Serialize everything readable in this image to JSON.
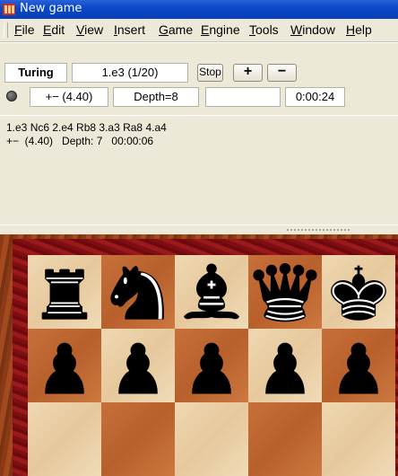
{
  "window": {
    "title": "New game"
  },
  "menu": [
    {
      "label": "File",
      "underline": "F",
      "rest": "ile"
    },
    {
      "label": "Edit",
      "underline": "E",
      "rest": "dit"
    },
    {
      "label": "View",
      "underline": "V",
      "rest": "iew"
    },
    {
      "label": "Insert",
      "underline": "I",
      "rest": "nsert"
    },
    {
      "label": "Game",
      "underline": "G",
      "rest": "ame"
    },
    {
      "label": "Engine",
      "underline": "E",
      "rest": "ngine"
    },
    {
      "label": "Tools",
      "underline": "T",
      "rest": "ools"
    },
    {
      "label": "Window",
      "underline": "W",
      "rest": "indow"
    },
    {
      "label": "Help",
      "underline": "H",
      "rest": "elp"
    }
  ],
  "engine": {
    "name": "Turing",
    "current_move": "1.e3 (1/20)",
    "stop_label": "Stop",
    "plus_label": "+",
    "minus_label": "−",
    "eval": "+−  (4.40)",
    "depth": "Depth=8",
    "extra": "",
    "time": "0:00:24",
    "analysis_line1": "1.e3 Nc6 2.e4 Rb8 3.a3 Ra8 4.a4",
    "analysis_line2": "+−  (4.40)   Depth: 7   00:00:06"
  },
  "board": {
    "rank8": [
      "rook",
      "knight",
      "bishop",
      "queen",
      "king"
    ],
    "rank7": [
      "pawn",
      "pawn",
      "pawn",
      "pawn",
      "pawn"
    ],
    "piece_color": "black",
    "colors": {
      "light": "#ecd2a8",
      "dark": "#c2682f",
      "frame": "#8a1416"
    }
  }
}
